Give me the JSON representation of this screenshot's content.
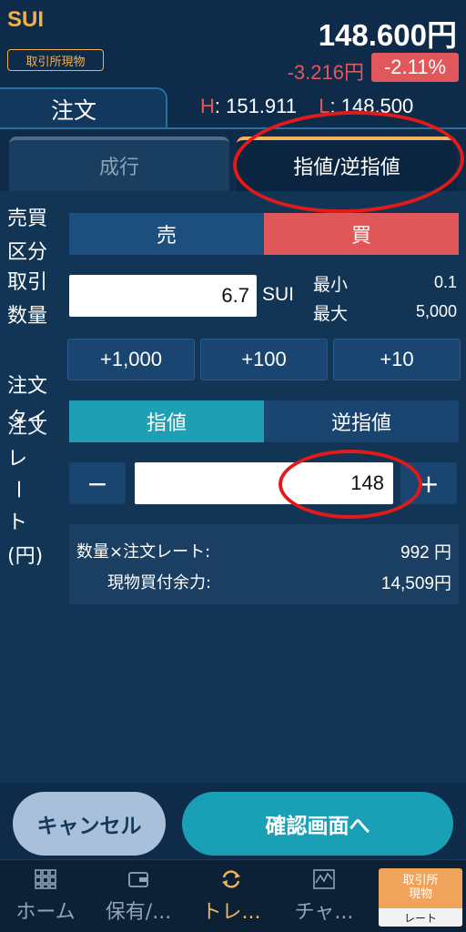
{
  "header": {
    "symbol": "SUI",
    "market_badge": "取引所現物",
    "price": "148.600円",
    "change": "-3.216円",
    "change_pct": "-2.11%"
  },
  "tabs": {
    "order": "注文",
    "high_key": "H",
    "high_val": ": 151.911",
    "low_key": "L",
    "low_val": ": 148.500"
  },
  "order_type_tabs": {
    "market": "成行",
    "limit_stop": "指値/逆指値"
  },
  "form": {
    "side_label_1": "売買",
    "side_label_2": "区分",
    "sell": "売",
    "buy": "買",
    "qty_label_1": "取引",
    "qty_label_2": "数量",
    "qty_value": "6.7",
    "qty_unit": "SUI",
    "min_label": "最小",
    "min_value": "0.1",
    "max_label": "最大",
    "max_value": "5,000",
    "inc_1000": "+1,000",
    "inc_100": "+100",
    "inc_10": "+10",
    "rate_label_1": "注文",
    "rate_label_2": "タイ",
    "rate_label_3": "注文",
    "rate_label_4": "レ",
    "rate_label_5": "ー",
    "rate_label_6": "ト",
    "rate_label_7": "(円)",
    "type_limit": "指値",
    "type_stop": "逆指値",
    "minus": "−",
    "plus": "+",
    "rate_value": "148",
    "sum_qty_rate_label": "数量×注文レート:",
    "sum_qty_rate_value": "992 円",
    "sum_available_label": "現物買付余力:",
    "sum_available_value": "14,509円"
  },
  "actions": {
    "cancel": "キャンセル",
    "confirm": "確認画面へ"
  },
  "nav": {
    "home": "ホーム",
    "holdings": "保有/...",
    "trade": "トレ...",
    "chart": "チャ...",
    "badge_top": "取引所\n現物",
    "badge_bottom": "レート"
  },
  "colors": {
    "background": "#0f2b4a",
    "accent_orange": "#f0b45e",
    "sell_blue": "#1d4f7e",
    "buy_red": "#e0575a",
    "teal": "#1aa0b6",
    "annotation_red": "#e11a1a"
  }
}
